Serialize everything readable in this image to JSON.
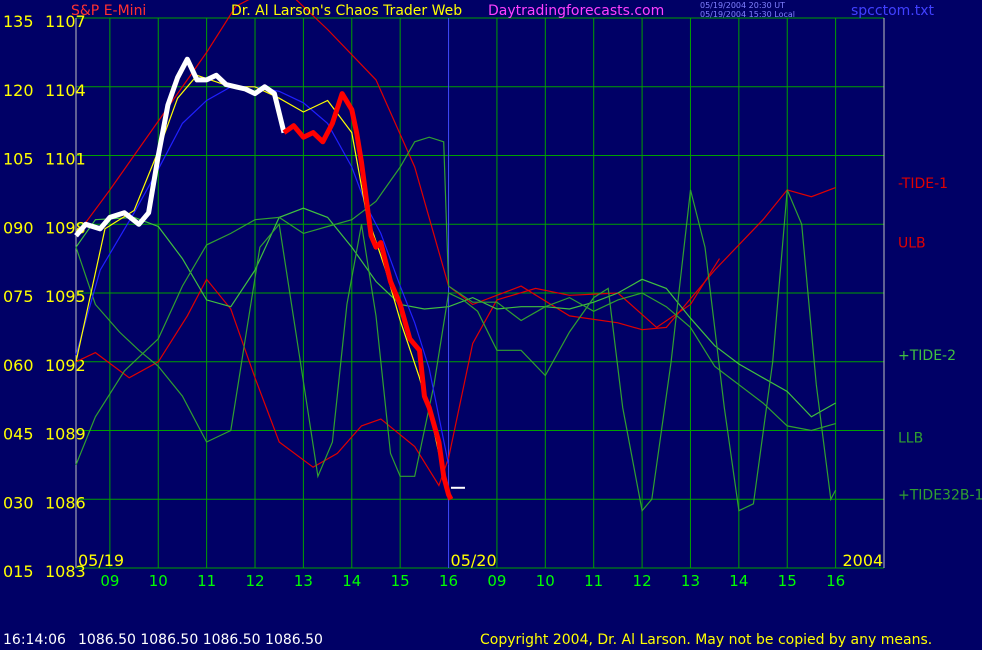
{
  "header": {
    "instrument": "S&P E-Mini",
    "title": "Dr. Al Larson's Chaos Trader Web",
    "site": "Daytradingforecasts.com",
    "stamp_line1": "05/19/2004 20:30 UT",
    "stamp_line2": "05/19/2004 15:30 Local",
    "file": "spcctom.txt"
  },
  "footer": {
    "time": "16:14:06",
    "quotes": "1086.50 1086.50 1086.50 1086.50",
    "copyright": "Copyright 2004, Dr. Al Larson. May not be copied by any means."
  },
  "colors": {
    "background": "#000066",
    "grid": "#00a000",
    "price_up": "#ffffff",
    "price_down": "#ff0000",
    "tide1": "#e00000",
    "lunar_band": "#e00000",
    "tide2": "#40c040",
    "tide32b": "#30a030",
    "trend": "#2020ff",
    "fit": "#ffff00",
    "axis_text": "#ffff00",
    "date_text": "#00ff00"
  },
  "chart_data": {
    "type": "line",
    "ylim": [
      1083,
      1107
    ],
    "y_ticks": [
      {
        "value": 1107,
        "osc": "135",
        "price": "1107"
      },
      {
        "value": 1104,
        "osc": "120",
        "price": "1104"
      },
      {
        "value": 1101,
        "osc": "105",
        "price": "1101"
      },
      {
        "value": 1098,
        "osc": "090",
        "price": "1098"
      },
      {
        "value": 1095,
        "osc": "075",
        "price": "1095"
      },
      {
        "value": 1092,
        "osc": "060",
        "price": "1092"
      },
      {
        "value": 1089,
        "osc": "045",
        "price": "1089"
      },
      {
        "value": 1086,
        "osc": "030",
        "price": "1086"
      },
      {
        "value": 1083,
        "osc": "015",
        "price": "1083"
      }
    ],
    "xlim": [
      8.3,
      25.0
    ],
    "x_ticks": [
      {
        "x": 9,
        "label": "09"
      },
      {
        "x": 10,
        "label": "10"
      },
      {
        "x": 11,
        "label": "11"
      },
      {
        "x": 12,
        "label": "12"
      },
      {
        "x": 13,
        "label": "13"
      },
      {
        "x": 14,
        "label": "14"
      },
      {
        "x": 15,
        "label": "15"
      },
      {
        "x": 16,
        "label": "16"
      },
      {
        "x": 17,
        "label": "09"
      },
      {
        "x": 18,
        "label": "10"
      },
      {
        "x": 19,
        "label": "11"
      },
      {
        "x": 20,
        "label": "12"
      },
      {
        "x": 21,
        "label": "13"
      },
      {
        "x": 22,
        "label": "14"
      },
      {
        "x": 23,
        "label": "15"
      },
      {
        "x": 24,
        "label": "16"
      }
    ],
    "day_markers": [
      {
        "x": 8.3,
        "label": "05/19"
      },
      {
        "x": 16.0,
        "label": "05/20"
      },
      {
        "x": 24.1,
        "label": "2004"
      }
    ],
    "series": [
      {
        "name": "-TIDE-1",
        "color": "#e00000",
        "x": [
          8.3,
          9.0,
          10.0,
          11.0,
          11.6,
          12.5,
          13.5,
          14.5,
          15.3,
          16.0,
          16.5,
          17.5,
          18.5,
          19.5,
          20.0,
          20.5,
          21.5,
          22.5,
          23.0,
          23.5,
          24.0
        ],
        "y": [
          1097.5,
          1099.5,
          1102.5,
          1105.5,
          1107.5,
          1108.5,
          1106.5,
          1104.3,
          1100.5,
          1095.3,
          1094.5,
          1095.3,
          1094.0,
          1093.7,
          1093.4,
          1093.5,
          1096.0,
          1098.2,
          1099.5,
          1099.2,
          1099.6
        ]
      },
      {
        "name": "ULB",
        "color": "#e00000",
        "x": [
          8.3,
          8.7,
          9.4,
          10.0,
          10.6,
          11.0,
          11.5,
          12.0,
          12.5,
          13.2,
          13.7,
          14.2,
          14.6,
          15.3,
          15.8,
          16.0,
          16.5,
          17.0,
          17.8,
          18.5,
          19.5,
          20.3,
          21.0,
          21.6
        ],
        "y": [
          1092.0,
          1092.4,
          1091.3,
          1092.0,
          1094.0,
          1095.6,
          1094.3,
          1091.3,
          1088.5,
          1087.4,
          1088.0,
          1089.2,
          1089.5,
          1088.3,
          1086.6,
          1087.8,
          1092.8,
          1094.7,
          1095.2,
          1094.9,
          1095.0,
          1093.5,
          1094.5,
          1096.5
        ]
      },
      {
        "name": "+TIDE-2",
        "color": "#40c040",
        "x": [
          8.3,
          8.7,
          9.5,
          10.0,
          10.5,
          11.0,
          11.5,
          12.0,
          12.5,
          13.0,
          13.5,
          14.0,
          14.5,
          15.0,
          15.5,
          16.0,
          16.5,
          17.0,
          17.5,
          18.0,
          18.5,
          19.0,
          19.5,
          20.0,
          20.5,
          21.0,
          21.5,
          22.0,
          22.5,
          23.0,
          23.5,
          24.0
        ],
        "y": [
          1097.0,
          1098.2,
          1098.3,
          1097.9,
          1096.5,
          1094.7,
          1094.4,
          1096.0,
          1098.3,
          1098.7,
          1098.3,
          1097.0,
          1095.5,
          1094.5,
          1094.3,
          1094.4,
          1094.8,
          1094.3,
          1094.4,
          1094.4,
          1094.3,
          1094.6,
          1095.0,
          1095.6,
          1095.2,
          1093.9,
          1092.7,
          1091.9,
          1091.3,
          1090.7,
          1089.6,
          1090.2
        ]
      },
      {
        "name": "LLB",
        "color": "#30a030",
        "x": [
          8.3,
          8.7,
          9.3,
          10.0,
          10.5,
          11.0,
          11.5,
          12.0,
          12.5,
          13.0,
          13.5,
          14.0,
          14.5,
          15.0,
          15.3,
          15.6,
          15.9,
          16.0,
          16.5,
          17.0,
          17.5,
          18.0,
          18.5,
          19.0,
          19.5,
          20.0,
          20.5,
          21.0,
          21.5,
          22.0,
          22.5,
          23.0,
          23.5,
          24.0
        ],
        "y": [
          1087.5,
          1089.6,
          1091.6,
          1093.0,
          1095.3,
          1097.1,
          1097.6,
          1098.2,
          1098.3,
          1097.6,
          1097.9,
          1098.2,
          1099.0,
          1100.5,
          1101.6,
          1101.8,
          1101.6,
          1095.3,
          1094.6,
          1094.6,
          1093.8,
          1094.4,
          1094.8,
          1094.2,
          1094.7,
          1095.0,
          1094.4,
          1093.5,
          1091.8,
          1091.0,
          1090.2,
          1089.2,
          1089.0,
          1089.3
        ]
      },
      {
        "name": "+TIDE32B-1",
        "color": "#30a030",
        "x": [
          8.3,
          8.7,
          9.2,
          9.6,
          10.0,
          10.5,
          11.0,
          11.5,
          11.8,
          12.1,
          12.5,
          12.9,
          13.3,
          13.6,
          13.9,
          14.2,
          14.5,
          14.8,
          15.0,
          15.3,
          15.7,
          16.0,
          16.3,
          16.6,
          17.0,
          17.5,
          18.0,
          18.5,
          19.0,
          19.3,
          19.6,
          20.0,
          20.2,
          20.6,
          21.0,
          21.3,
          21.7,
          22.0,
          22.3,
          22.7,
          23.0,
          23.3,
          23.6,
          23.9,
          24.0
        ],
        "y": [
          1097.0,
          1094.5,
          1093.3,
          1092.5,
          1091.8,
          1090.5,
          1088.5,
          1089.0,
          1093.0,
          1097.0,
          1098.0,
          1092.5,
          1087.0,
          1088.5,
          1094.5,
          1098.0,
          1094.0,
          1088.0,
          1087.0,
          1087.0,
          1091.0,
          1095.0,
          1094.7,
          1094.2,
          1092.5,
          1092.5,
          1091.4,
          1093.3,
          1094.8,
          1095.2,
          1090.0,
          1085.5,
          1086.0,
          1092.0,
          1099.5,
          1097.0,
          1090.0,
          1085.5,
          1085.8,
          1092.0,
          1099.5,
          1098.0,
          1091.0,
          1086.0,
          1086.4
        ]
      },
      {
        "name": "trend",
        "color": "#2020ff",
        "x": [
          8.3,
          8.8,
          9.5,
          10.0,
          10.5,
          11.0,
          11.5,
          12.0,
          12.5,
          13.0,
          13.5,
          14.0,
          14.3,
          14.6,
          15.0,
          15.3,
          15.6,
          16.0
        ],
        "y": [
          1092.3,
          1096.0,
          1098.5,
          1100.4,
          1102.4,
          1103.4,
          1104.0,
          1104.0,
          1103.8,
          1103.3,
          1102.4,
          1100.5,
          1098.8,
          1097.6,
          1095.3,
          1093.7,
          1091.7,
          1087.5
        ]
      },
      {
        "name": "fit",
        "color": "#ffff00",
        "x": [
          8.3,
          8.9,
          9.5,
          10.0,
          10.4,
          10.8,
          11.5,
          12.0,
          12.5,
          13.0,
          13.5,
          14.0,
          14.3,
          14.7,
          15.0,
          15.4,
          15.7,
          16.0
        ],
        "y": [
          1092.0,
          1097.8,
          1098.6,
          1101.2,
          1103.5,
          1104.5,
          1104.0,
          1104.0,
          1103.5,
          1102.9,
          1103.4,
          1102.0,
          1098.5,
          1096.0,
          1093.8,
          1091.3,
          1089.0,
          1086.0
        ]
      },
      {
        "name": "price",
        "color": "#ffffff",
        "down_color": "#ff0000",
        "x": [
          8.3,
          8.5,
          8.8,
          9.0,
          9.3,
          9.6,
          9.8,
          10.0,
          10.2,
          10.4,
          10.6,
          10.8,
          11.0,
          11.2,
          11.4,
          11.6,
          11.8,
          12.0,
          12.2,
          12.4,
          12.6,
          12.8,
          13.0,
          13.2,
          13.4,
          13.6,
          13.8,
          14.0,
          14.1,
          14.2,
          14.4,
          14.5,
          14.6,
          14.8,
          15.0,
          15.2,
          15.4,
          15.5,
          15.6,
          15.8,
          15.9,
          16.0,
          16.05
        ],
        "y": [
          1097.5,
          1098.0,
          1097.8,
          1098.3,
          1098.5,
          1098.0,
          1098.5,
          1101.0,
          1103.2,
          1104.4,
          1105.2,
          1104.3,
          1104.3,
          1104.5,
          1104.1,
          1104.0,
          1103.9,
          1103.7,
          1104.0,
          1103.7,
          1102.0,
          1102.3,
          1101.8,
          1102.0,
          1101.6,
          1102.4,
          1103.7,
          1103.0,
          1102.0,
          1100.7,
          1097.5,
          1097.0,
          1097.2,
          1095.5,
          1094.5,
          1093.0,
          1092.5,
          1090.5,
          1090.0,
          1088.5,
          1087.0,
          1086.2,
          1086.0
        ],
        "down_from_x": 12.6
      }
    ],
    "series_labels": [
      {
        "text": "-TIDE-1",
        "color": "#e00000",
        "y": 1099.8
      },
      {
        "text": "ULB",
        "color": "#e00000",
        "y": 1097.2
      },
      {
        "text": "+TIDE-2",
        "color": "#40c040",
        "y": 1092.3
      },
      {
        "text": "LLB",
        "color": "#30a030",
        "y": 1088.7
      },
      {
        "text": "+TIDE32B-1",
        "color": "#30a030",
        "y": 1086.2
      }
    ],
    "last_price": 1086.5
  }
}
